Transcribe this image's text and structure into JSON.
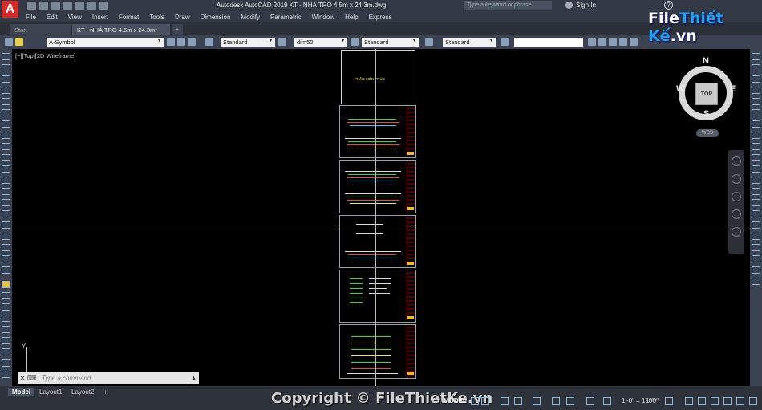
{
  "titlebar": {
    "app_icon": "A",
    "title": "Autodesk AutoCAD 2019    KT - NHÀ TRO 4.5m x 24.3m.dwg",
    "search_placeholder": "Type a keyword or phrase",
    "signin": "Sign In",
    "help": "?"
  },
  "watermark": {
    "part1": "File",
    "part2": "Thiết Kế",
    "part3": ".vn"
  },
  "menu": [
    "File",
    "Edit",
    "View",
    "Insert",
    "Format",
    "Tools",
    "Draw",
    "Dimension",
    "Modify",
    "Parametric",
    "Window",
    "Help",
    "Express"
  ],
  "tabs": {
    "start": "Start",
    "active": "KT - NHÀ TRO 4.5m x 24.3m*",
    "add": "+"
  },
  "properties": {
    "layer": "A-Symbol",
    "text_style": "Standard",
    "dim_style": "dim50",
    "table_style": "Standard",
    "multileader_style": "Standard"
  },
  "viewport": {
    "label": "[−][Top][2D Wireframe]",
    "cover_text": "PHẦN KIẾN TRÚC",
    "ucs_y": "Y"
  },
  "viewcube": {
    "north": "N",
    "south": "S",
    "east": "E",
    "west": "W",
    "face": "TOP",
    "wcs": "WCS"
  },
  "commandline": {
    "close": "✕",
    "prompt": "⌨",
    "placeholder": "Type a command"
  },
  "layouts": [
    "Model",
    "Layout1",
    "Layout2"
  ],
  "layout_add": "+",
  "status": {
    "model": "MODEL",
    "scale1": "1'-0\" = 1'-0\"",
    "scale2": "1'-0\""
  },
  "copyright": "Copyright © FileThietKe.vn",
  "colors": {
    "title_bg": "#333a46",
    "toolbar_bg": "#3b4251",
    "accent_red": "#d42a2a",
    "watermark_blue": "#21a0ef"
  }
}
